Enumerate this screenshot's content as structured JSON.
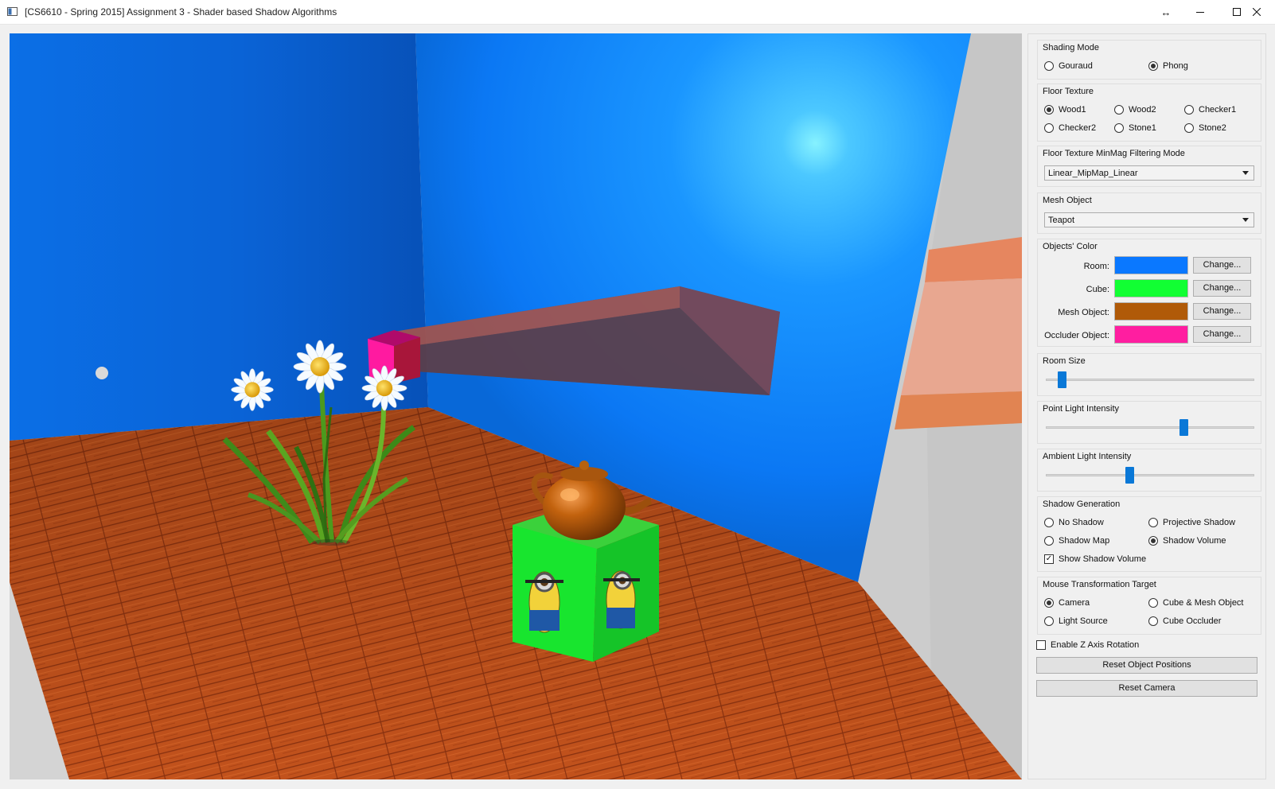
{
  "window": {
    "title": "[CS6610 - Spring 2015] Assignment 3 - Shader based Shadow Algorithms",
    "controls": {
      "resize": "↔",
      "minimize": "—",
      "maximize": "☐",
      "close": "✕"
    }
  },
  "scene": {
    "colors": {
      "room": "#0a78ff",
      "floor": "#c8501a",
      "cube": "#11ff33",
      "mesh": "#b05a08",
      "occluder": "#ff1ea0",
      "shadow_volume": "#b3a9a3",
      "light": "#7ee8ff"
    }
  },
  "panel": {
    "shading_mode": {
      "title": "Shading Mode",
      "options": [
        {
          "label": "Gouraud",
          "checked": false
        },
        {
          "label": "Phong",
          "checked": true
        }
      ]
    },
    "floor_texture": {
      "title": "Floor Texture",
      "options": [
        {
          "label": "Wood1",
          "checked": true
        },
        {
          "label": "Wood2",
          "checked": false
        },
        {
          "label": "Checker1",
          "checked": false
        },
        {
          "label": "Checker2",
          "checked": false
        },
        {
          "label": "Stone1",
          "checked": false
        },
        {
          "label": "Stone2",
          "checked": false
        }
      ]
    },
    "filtering": {
      "title": "Floor Texture MinMag Filtering Mode",
      "value": "Linear_MipMap_Linear"
    },
    "mesh_object": {
      "title": "Mesh Object",
      "value": "Teapot"
    },
    "objects_color": {
      "title": "Objects' Color",
      "rows": [
        {
          "label": "Room:",
          "color": "#0a78ff",
          "button": "Change..."
        },
        {
          "label": "Cube:",
          "color": "#11ff33",
          "button": "Change..."
        },
        {
          "label": "Mesh Object:",
          "color": "#b05a08",
          "button": "Change..."
        },
        {
          "label": "Occluder Object:",
          "color": "#ff1ea0",
          "button": "Change..."
        }
      ]
    },
    "room_size": {
      "title": "Room Size",
      "value": 0.06
    },
    "point_light": {
      "title": "Point Light Intensity",
      "value": 0.67
    },
    "ambient_light": {
      "title": "Ambient Light Intensity",
      "value": 0.4
    },
    "shadow_generation": {
      "title": "Shadow Generation",
      "options": [
        {
          "label": "No Shadow",
          "checked": false
        },
        {
          "label": "Projective Shadow",
          "checked": false
        },
        {
          "label": "Shadow Map",
          "checked": false
        },
        {
          "label": "Shadow Volume",
          "checked": true
        }
      ],
      "show_volume": {
        "label": "Show Shadow Volume",
        "checked": true
      }
    },
    "mouse_target": {
      "title": "Mouse Transformation Target",
      "options": [
        {
          "label": "Camera",
          "checked": true
        },
        {
          "label": "Cube & Mesh Object",
          "checked": false
        },
        {
          "label": "Light Source",
          "checked": false
        },
        {
          "label": "Cube Occluder",
          "checked": false
        }
      ]
    },
    "z_rotation": {
      "label": "Enable Z Axis Rotation",
      "checked": false
    },
    "reset_objects": "Reset Object Positions",
    "reset_camera": "Reset Camera"
  }
}
